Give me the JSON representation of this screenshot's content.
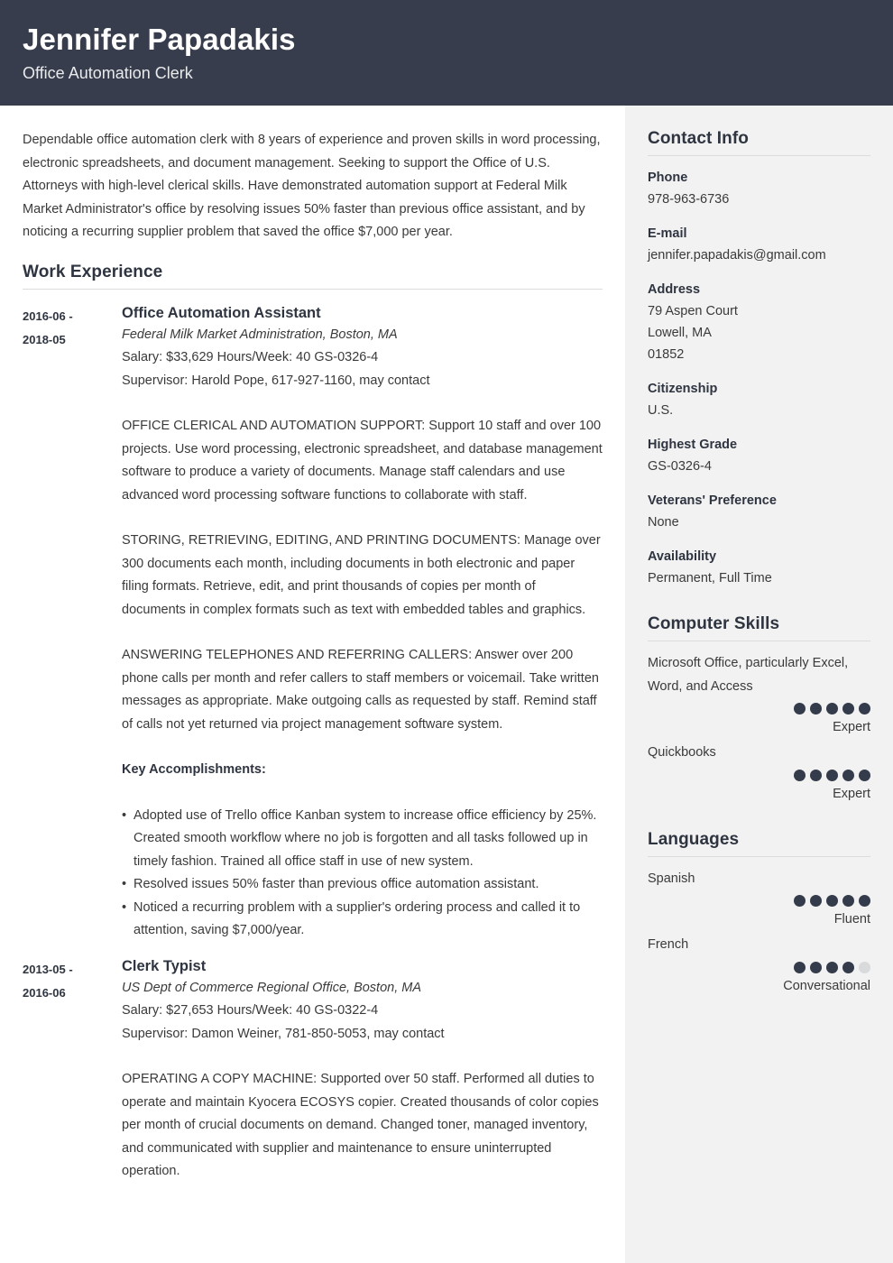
{
  "header": {
    "name": "Jennifer Papadakis",
    "job_title": "Office Automation Clerk",
    "background_color": "#373d4c"
  },
  "main": {
    "summary": "Dependable office automation clerk with 8 years of experience and proven skills in word processing, electronic spreadsheets, and document management. Seeking to support the Office of U.S. Attorneys with high-level clerical skills. Have demonstrated automation support at Federal Milk Market Administrator's office by resolving issues 50% faster than previous office assistant, and by noticing a recurring supplier problem that saved the office $7,000 per year.",
    "work_experience_heading": "Work Experience",
    "jobs": [
      {
        "date_start": "2016-06 -",
        "date_end": "2018-05",
        "title": "Office Automation Assistant",
        "organization": "Federal Milk Market Administration, Boston, MA",
        "salary_line": "Salary: $33,629  Hours/Week: 40  GS-0326-4",
        "supervisor_line": "Supervisor: Harold Pope, 617-927-1160, may contact",
        "paragraphs": [
          "OFFICE CLERICAL AND AUTOMATION SUPPORT: Support 10 staff and over 100 projects. Use word processing, electronic spreadsheet, and database management software to produce a variety of documents. Manage staff calendars and use advanced word processing software functions to collaborate with staff.",
          "STORING, RETRIEVING, EDITING, AND PRINTING DOCUMENTS: Manage over 300 documents each month, including documents in both electronic and paper filing formats. Retrieve, edit, and print thousands of copies per month of documents in complex formats such as text with embedded tables and graphics.",
          "ANSWERING TELEPHONES AND REFERRING CALLERS: Answer over 200 phone calls per month and refer callers to staff members or voicemail. Take written messages as appropriate. Make outgoing calls as requested by staff. Remind staff of calls not yet returned via project management software system."
        ],
        "accomplishments_label": "Key Accomplishments:",
        "bullets": [
          "Adopted use of Trello office Kanban system to increase office efficiency by 25%. Created smooth workflow where no job is forgotten and all tasks followed up in timely fashion. Trained all office staff in use of new system.",
          "Resolved issues 50% faster than previous office automation assistant.",
          "Noticed a recurring problem with a supplier's ordering process and called it to attention, saving $7,000/year."
        ]
      },
      {
        "date_start": "2013-05 -",
        "date_end": "2016-06",
        "title": "Clerk Typist",
        "organization": "US Dept of Commerce Regional Office, Boston, MA",
        "salary_line": "Salary: $27,653  Hours/Week: 40  GS-0322-4",
        "supervisor_line": "Supervisor: Damon Weiner, 781-850-5053, may contact",
        "paragraphs": [
          "OPERATING A COPY MACHINE: Supported over 50 staff. Performed all duties to operate and maintain Kyocera ECOSYS copier. Created thousands of color copies per month of crucial documents on demand. Changed toner, managed inventory, and communicated with supplier and maintenance to ensure uninterrupted operation."
        ],
        "accomplishments_label": "",
        "bullets": []
      }
    ]
  },
  "sidebar": {
    "contact_heading": "Contact Info",
    "contact_blocks": [
      {
        "label": "Phone",
        "values": [
          "978-963-6736"
        ]
      },
      {
        "label": "E-mail",
        "values": [
          "jennifer.papadakis@gmail.com"
        ]
      },
      {
        "label": "Address",
        "values": [
          "79 Aspen Court",
          "Lowell, MA",
          "01852"
        ]
      },
      {
        "label": "Citizenship",
        "values": [
          "U.S."
        ]
      },
      {
        "label": "Highest Grade",
        "values": [
          "GS-0326-4"
        ]
      },
      {
        "label": "Veterans' Preference",
        "values": [
          "None"
        ]
      },
      {
        "label": "Availability",
        "values": [
          "Permanent, Full Time"
        ]
      }
    ],
    "computer_skills_heading": "Computer Skills",
    "computer_skills": [
      {
        "name": "Microsoft Office, particularly Excel, Word, and Access",
        "rating": 5,
        "max": 5,
        "level": "Expert"
      },
      {
        "name": "Quickbooks",
        "rating": 5,
        "max": 5,
        "level": "Expert"
      }
    ],
    "languages_heading": "Languages",
    "languages": [
      {
        "name": "Spanish",
        "rating": 5,
        "max": 5,
        "level": "Fluent"
      },
      {
        "name": "French",
        "rating": 4,
        "max": 5,
        "level": "Conversational"
      }
    ],
    "background_color": "#f2f2f2",
    "dot_on_color": "#343b4a",
    "dot_off_color": "#d9dadb"
  }
}
